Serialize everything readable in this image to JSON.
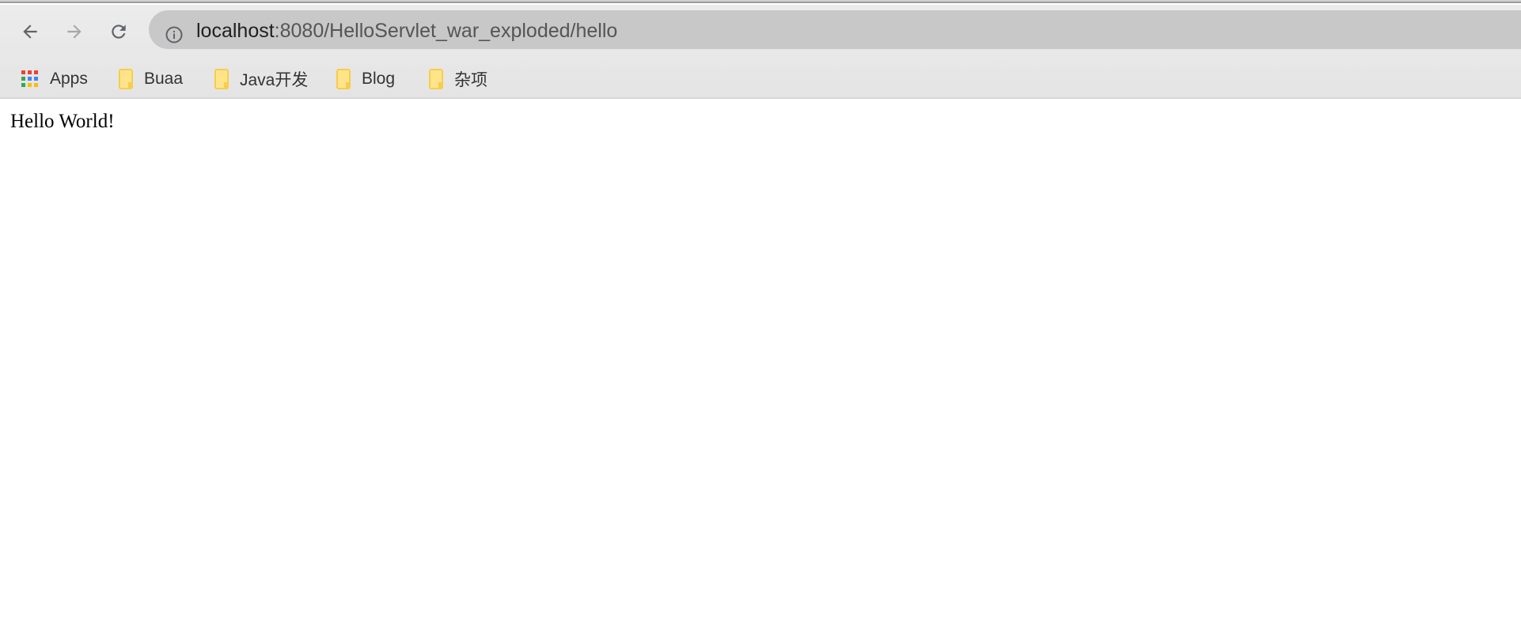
{
  "browser": {
    "url_host": "localhost",
    "url_path": ":8080/HelloServlet_war_exploded/hello",
    "nav_icons": [
      "back-arrow-icon",
      "forward-arrow-icon",
      "reload-icon",
      "info-icon"
    ],
    "bookmarks": [
      {
        "label": "Apps",
        "icon": "apps-grid-icon"
      },
      {
        "label": "Buaa",
        "icon": "folder-icon"
      },
      {
        "label": "Java开发",
        "icon": "folder-icon"
      },
      {
        "label": "Blog",
        "icon": "folder-icon"
      },
      {
        "label": "杂项",
        "icon": "folder-icon"
      }
    ]
  },
  "page": {
    "text": "Hello World!"
  }
}
